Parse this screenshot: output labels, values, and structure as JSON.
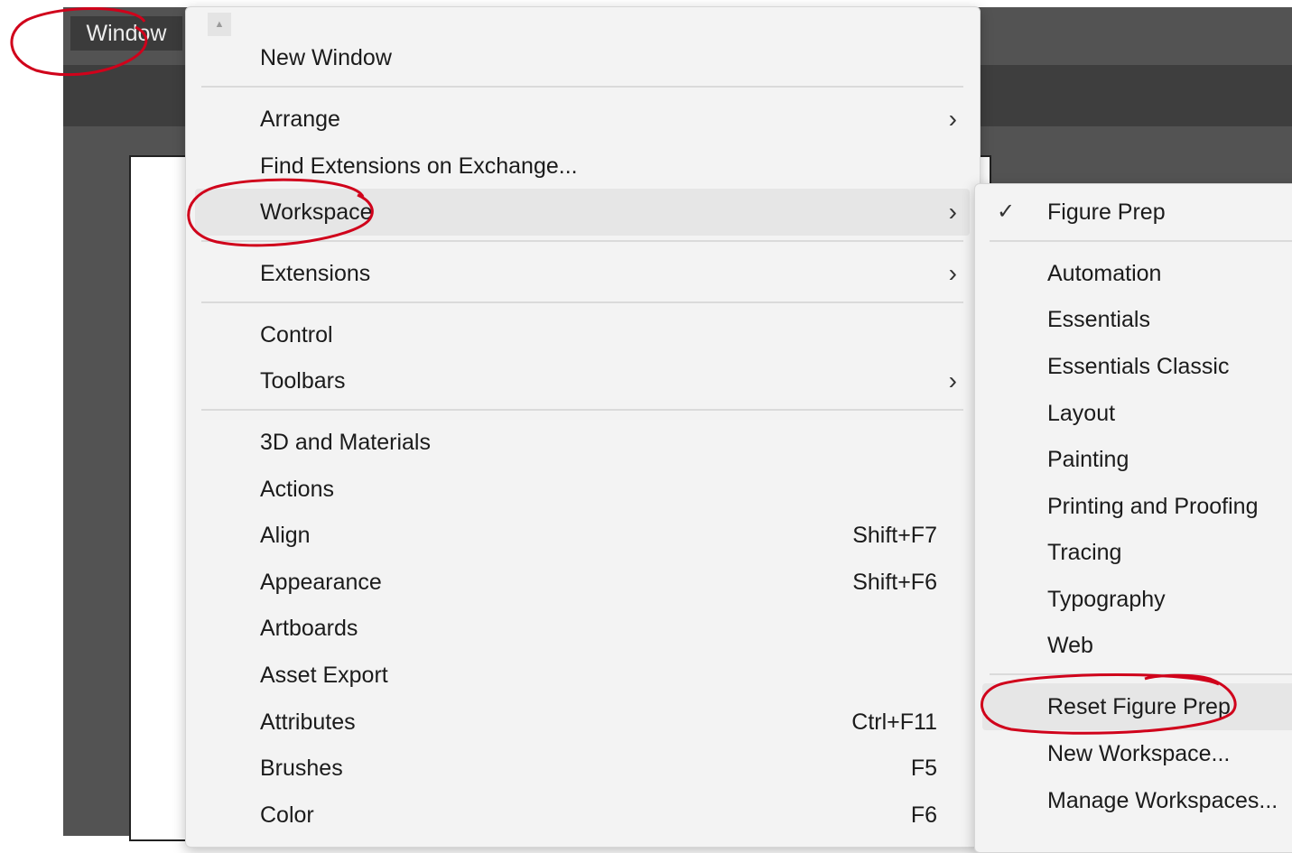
{
  "menubar": {
    "window_label": "Window"
  },
  "window_menu": {
    "items": [
      {
        "label": "New Window",
        "shortcut": ""
      },
      {
        "label": "Arrange",
        "shortcut": ""
      },
      {
        "label": "Find Extensions on Exchange...",
        "shortcut": ""
      },
      {
        "label": "Workspace",
        "shortcut": ""
      },
      {
        "label": "Extensions",
        "shortcut": ""
      },
      {
        "label": "Control",
        "shortcut": ""
      },
      {
        "label": "Toolbars",
        "shortcut": ""
      },
      {
        "label": "3D and Materials",
        "shortcut": ""
      },
      {
        "label": "Actions",
        "shortcut": ""
      },
      {
        "label": "Align",
        "shortcut": "Shift+F7"
      },
      {
        "label": "Appearance",
        "shortcut": "Shift+F6"
      },
      {
        "label": "Artboards",
        "shortcut": ""
      },
      {
        "label": "Asset Export",
        "shortcut": ""
      },
      {
        "label": "Attributes",
        "shortcut": "Ctrl+F11"
      },
      {
        "label": "Brushes",
        "shortcut": "F5"
      },
      {
        "label": "Color",
        "shortcut": "F6"
      }
    ],
    "submenu_arrow": "›",
    "scroll_up": "▲"
  },
  "workspace_submenu": {
    "check_mark": "✓",
    "items": [
      {
        "label": "Figure Prep"
      },
      {
        "label": "Automation"
      },
      {
        "label": "Essentials"
      },
      {
        "label": "Essentials Classic"
      },
      {
        "label": "Layout"
      },
      {
        "label": "Painting"
      },
      {
        "label": "Printing and Proofing"
      },
      {
        "label": "Tracing"
      },
      {
        "label": "Typography"
      },
      {
        "label": "Web"
      },
      {
        "label": "Reset Figure Prep"
      },
      {
        "label": "New Workspace..."
      },
      {
        "label": "Manage Workspaces..."
      }
    ]
  },
  "colors": {
    "menu_bg": "#f3f3f3",
    "highlight": "#e6e6e6",
    "annotation_red": "#d0021b",
    "app_dark": "#535353"
  }
}
